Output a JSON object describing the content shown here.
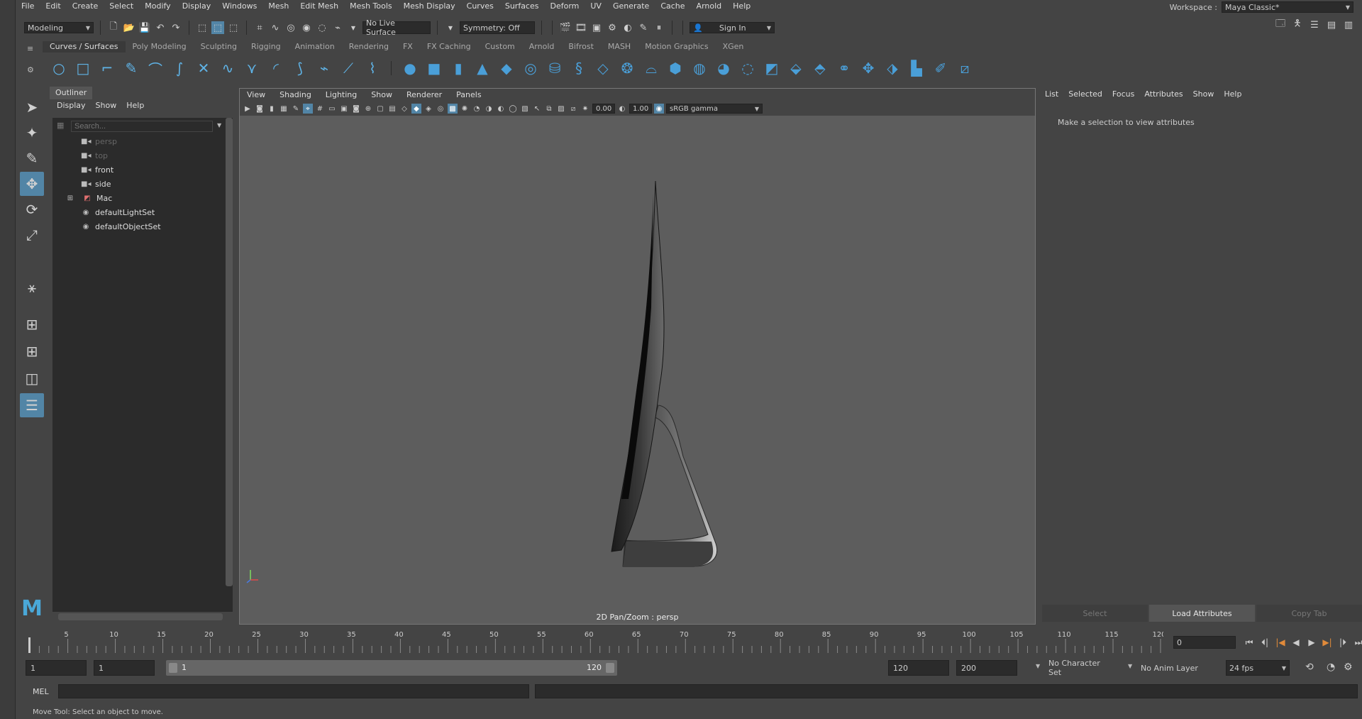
{
  "menubar": {
    "items": [
      "File",
      "Edit",
      "Create",
      "Select",
      "Modify",
      "Display",
      "Windows",
      "Mesh",
      "Edit Mesh",
      "Mesh Tools",
      "Mesh Display",
      "Curves",
      "Surfaces",
      "Deform",
      "UV",
      "Generate",
      "Cache",
      "Arnold",
      "Help"
    ],
    "workspace_label": "Workspace :",
    "workspace_value": "Maya Classic*"
  },
  "statusline": {
    "mode": "Modeling",
    "live_surface": "No Live Surface",
    "symmetry": "Symmetry: Off",
    "sign_in": "Sign In"
  },
  "shelf": {
    "tabs": [
      "Curves / Surfaces",
      "Poly Modeling",
      "Sculpting",
      "Rigging",
      "Animation",
      "Rendering",
      "FX",
      "FX Caching",
      "Custom",
      "Arnold",
      "Bifrost",
      "MASH",
      "Motion Graphics",
      "XGen"
    ],
    "active_tab": "Curves / Surfaces"
  },
  "outliner": {
    "title": "Outliner",
    "menus": [
      "Display",
      "Show",
      "Help"
    ],
    "search_placeholder": "Search...",
    "items": [
      {
        "label": "persp",
        "icon": "camera-icon",
        "dim": true
      },
      {
        "label": "top",
        "icon": "camera-icon",
        "dim": true
      },
      {
        "label": "front",
        "icon": "camera-icon",
        "dim": false
      },
      {
        "label": "side",
        "icon": "camera-icon",
        "dim": false
      },
      {
        "label": "Mac",
        "icon": "group-icon",
        "dim": false,
        "expandable": true
      },
      {
        "label": "defaultLightSet",
        "icon": "set-icon",
        "dim": false
      },
      {
        "label": "defaultObjectSet",
        "icon": "set-icon",
        "dim": false
      }
    ]
  },
  "viewport": {
    "menus": [
      "View",
      "Shading",
      "Lighting",
      "Show",
      "Renderer",
      "Panels"
    ],
    "exposure": "0.00",
    "gamma": "1.00",
    "color_space": "sRGB gamma",
    "caption": "2D Pan/Zoom : persp"
  },
  "attribute_editor": {
    "menus": [
      "List",
      "Selected",
      "Focus",
      "Attributes",
      "Show",
      "Help"
    ],
    "message": "Make a selection to view attributes",
    "buttons": {
      "select": "Select",
      "load": "Load Attributes",
      "copy": "Copy Tab"
    }
  },
  "timeslider": {
    "tick_labels": [
      "5",
      "10",
      "15",
      "20",
      "25",
      "30",
      "35",
      "40",
      "45",
      "50",
      "55",
      "60",
      "65",
      "70",
      "75",
      "80",
      "85",
      "90",
      "95",
      "100",
      "105",
      "110",
      "115",
      "120"
    ],
    "current_frame": "0"
  },
  "range": {
    "start": "1",
    "playback_start": "1",
    "slider_start": "1",
    "slider_end": "120",
    "playback_end": "120",
    "end": "200",
    "character_set": "No Character Set",
    "anim_layer": "No Anim Layer",
    "fps": "24 fps"
  },
  "commandline": {
    "label": "MEL"
  },
  "helpline": {
    "text": "Move Tool: Select an object to move."
  },
  "colors": {
    "accent": "#5285a6",
    "shelf_icon": "#5fb3e6",
    "background": "#444444",
    "viewport_bg": "#5d5d5d"
  }
}
